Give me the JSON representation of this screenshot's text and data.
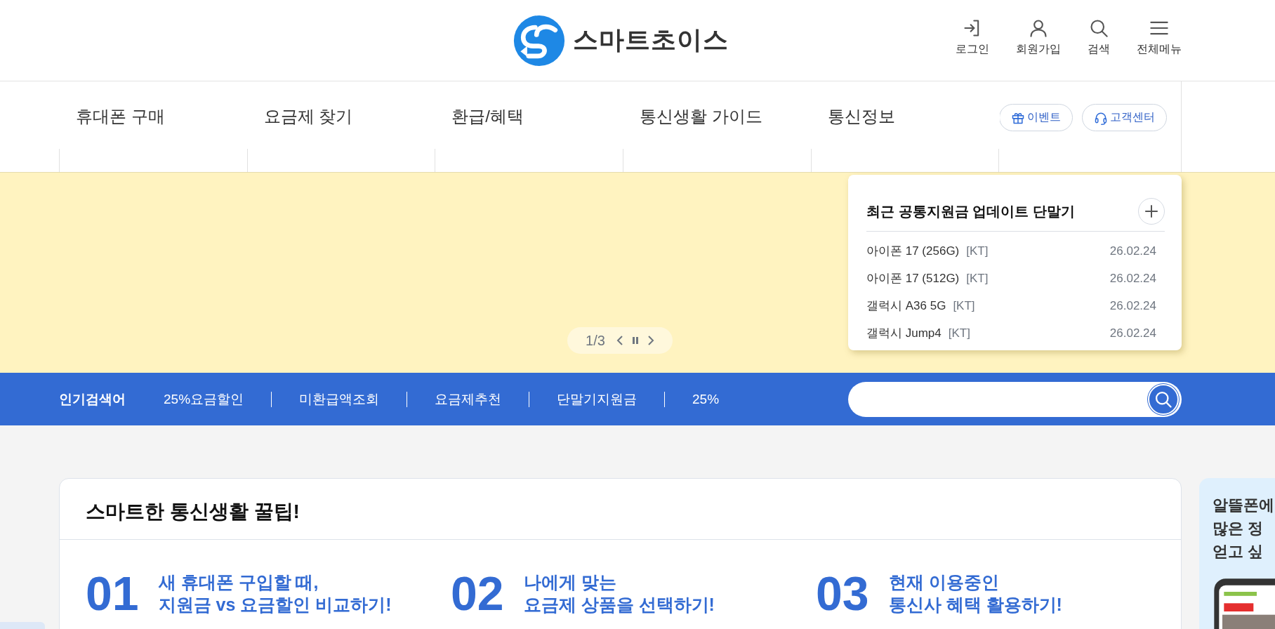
{
  "header": {
    "logo": {
      "text": "스마트초이스"
    },
    "utilities": [
      {
        "label": "로그인",
        "kind": "login"
      },
      {
        "label": "회원가입",
        "kind": "person"
      },
      {
        "label": "검색",
        "kind": "search"
      },
      {
        "label": "전체메뉴",
        "kind": "menu"
      }
    ]
  },
  "nav": {
    "items": [
      "휴대폰 구매",
      "요금제 찾기",
      "환급/혜택",
      "통신생활 가이드",
      "통신정보"
    ],
    "buttons": [
      {
        "label": "이벤트",
        "kind": "gift"
      },
      {
        "label": "고객센터",
        "kind": "headset"
      }
    ]
  },
  "banner": {
    "pager": {
      "text": "1/3"
    },
    "recent": {
      "title": "최근 공통지원금 업데이트 단말기",
      "items": [
        {
          "name": "아이폰 17 (256G)",
          "carrier": "[KT]",
          "date": "26.02.24"
        },
        {
          "name": "아이폰 17 (512G)",
          "carrier": "[KT]",
          "date": "26.02.24"
        },
        {
          "name": "갤럭시 A36 5G",
          "carrier": "[KT]",
          "date": "26.02.24"
        },
        {
          "name": "갤럭시 Jump4",
          "carrier": "[KT]",
          "date": "26.02.24"
        }
      ]
    }
  },
  "popular": {
    "title": "인기검색어",
    "terms": [
      "25%요금할인",
      "미환급액조회",
      "요금제추천",
      "단말기지원금",
      "25%"
    ]
  },
  "tips": {
    "title": "스마트한 통신생활 꿀팁!",
    "items": [
      {
        "number": "01",
        "lines": [
          "새 휴대폰 구입할 때,",
          "지원금 vs 요금할인 비교하기!"
        ]
      },
      {
        "number": "02",
        "lines": [
          "나에게 맞는",
          "요금제 상품을 선택하기!"
        ]
      },
      {
        "number": "03",
        "lines": [
          "현재 이용중인",
          "통신사 혜택 활용하기!"
        ]
      }
    ]
  },
  "promo": {
    "lines": [
      "알뜰폰에",
      "많은 정",
      "얻고 싶"
    ]
  }
}
